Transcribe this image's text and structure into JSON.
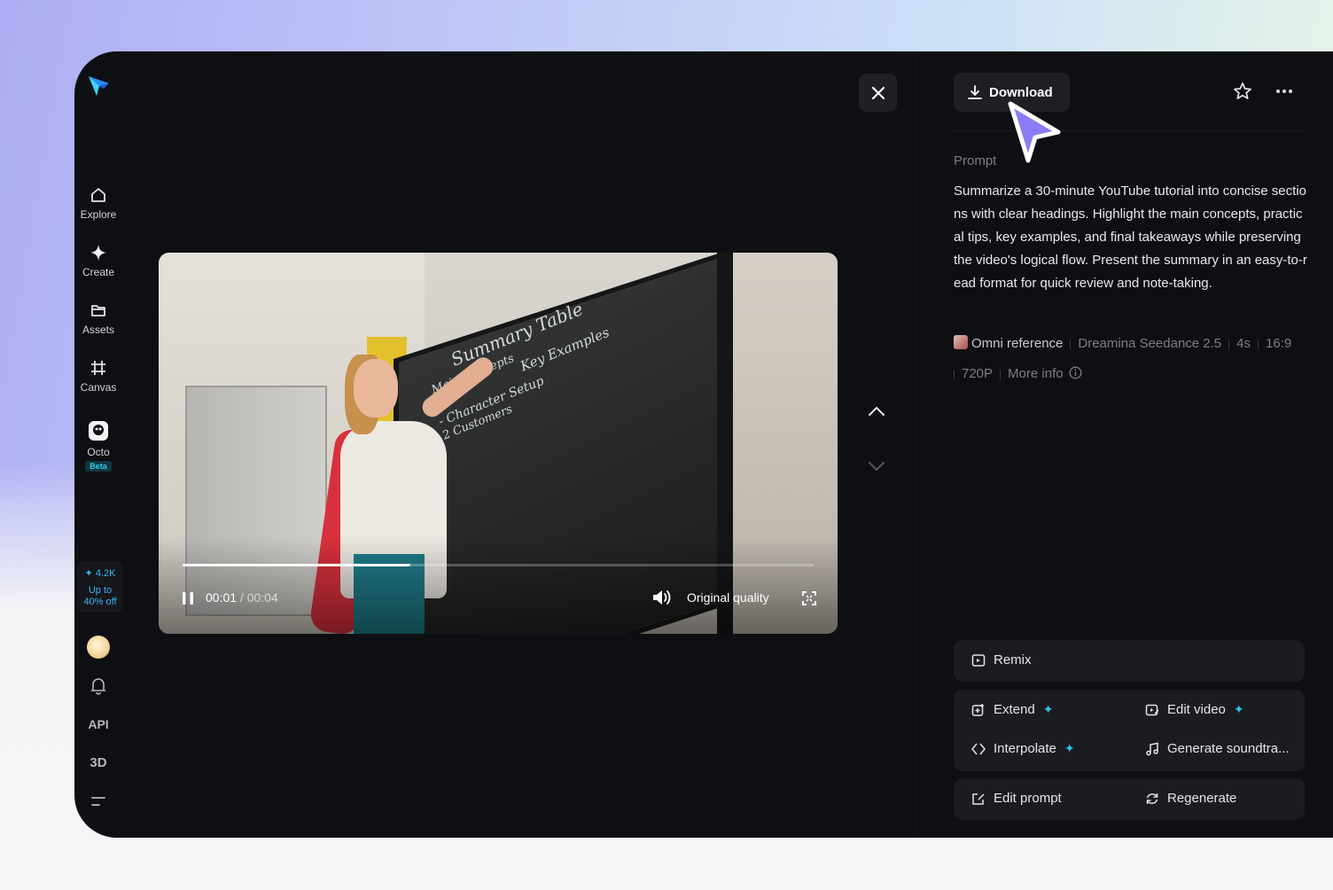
{
  "nav": {
    "items": [
      {
        "label": "Explore",
        "icon": "home-icon"
      },
      {
        "label": "Create",
        "icon": "sparkle-icon"
      },
      {
        "label": "Assets",
        "icon": "folder-icon"
      },
      {
        "label": "Canvas",
        "icon": "canvas-icon"
      },
      {
        "label": "Octo",
        "icon": "octo-icon",
        "badge": "Beta"
      }
    ],
    "promo": {
      "credits": "✦ 4.2K",
      "line1": "Up to",
      "line2": "40% off"
    },
    "api_label": "API",
    "three_d_label": "3D"
  },
  "video": {
    "current_time": "00:01",
    "duration": "/ 00:04",
    "progress": 0.36,
    "quality_label": "Original quality",
    "board_text": [
      "Summary Table",
      "Main Concepts",
      "Key Examples",
      "- Character Setup",
      "- 2 Customers"
    ]
  },
  "panel": {
    "download_label": "Download",
    "prompt_label": "Prompt",
    "prompt_text": "Summarize a 30-minute YouTube tutorial into concise sections with clear headings. Highlight the main concepts, practical tips, key examples, and final takeaways while preserving the video's logical flow. Present the summary in an easy-to-read format for quick review and note-taking.",
    "meta": {
      "reference": "Omni reference",
      "model": "Dreamina Seedance 2.5",
      "duration": "4s",
      "ratio": "16:9",
      "resolution": "720P",
      "more_info": "More info"
    },
    "actions": {
      "remix": "Remix",
      "extend": "Extend",
      "edit_video": "Edit video",
      "interpolate": "Interpolate",
      "generate_soundtrack": "Generate soundtra...",
      "edit_prompt": "Edit prompt",
      "regenerate": "Regenerate"
    }
  },
  "colors": {
    "accent": "#2ec4f2",
    "cursor": "#8b7cf6",
    "background": "#0e0f13"
  }
}
